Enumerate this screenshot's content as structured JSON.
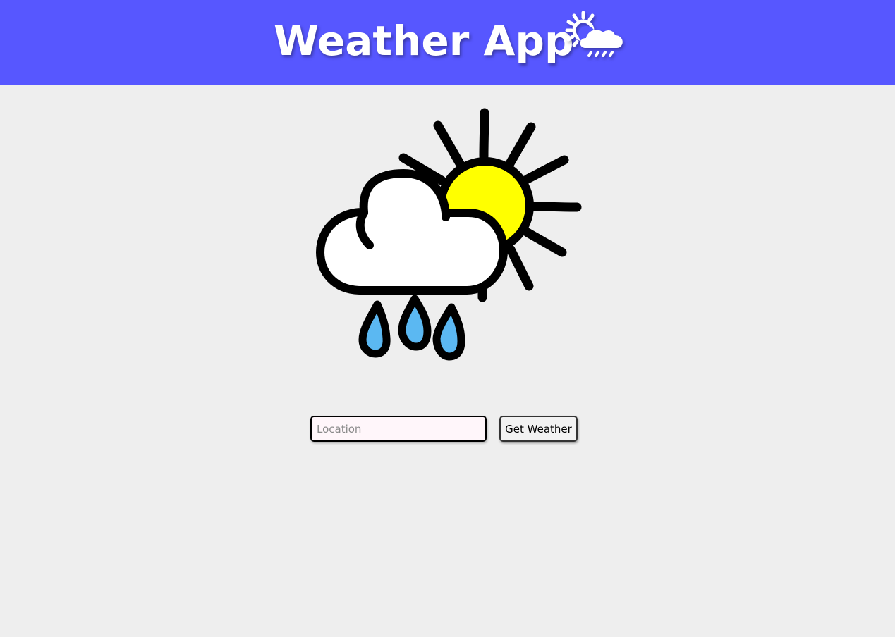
{
  "header": {
    "title": "Weather App",
    "icon": "sun-cloud-rain-icon",
    "background_color": "#5757ff",
    "text_color": "#ffffff"
  },
  "hero": {
    "icon": "partly-cloudy-rain-icon",
    "sun_color": "#ffff00",
    "raindrop_color": "#5bb8f2",
    "cloud_color": "#ffffff"
  },
  "search": {
    "placeholder": "Location",
    "value": "",
    "button_label": "Get Weather"
  },
  "page": {
    "background_color": "#eeeeee"
  }
}
